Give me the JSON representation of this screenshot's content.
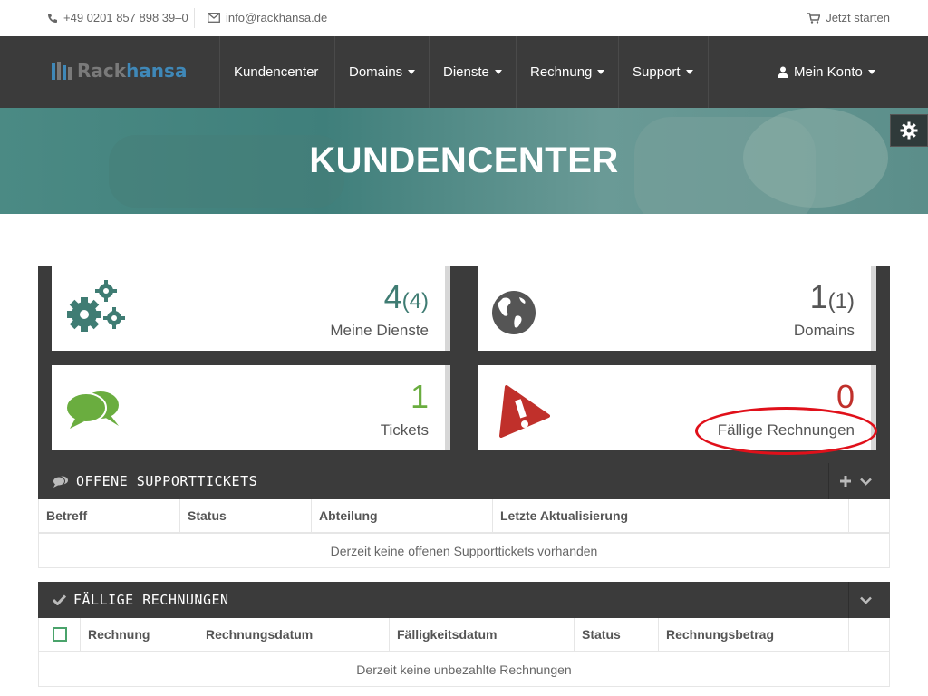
{
  "topbar": {
    "phone": "+49 0201 857 898 39–0",
    "email": "info@rackhansa.de",
    "start": "Jetzt starten"
  },
  "logo": {
    "part1": "Rack",
    "part2": "hansa"
  },
  "nav": {
    "items": [
      {
        "label": "Kundencenter"
      },
      {
        "label": "Domains"
      },
      {
        "label": "Dienste"
      },
      {
        "label": "Rechnung"
      },
      {
        "label": "Support"
      }
    ],
    "account": "Mein Konto"
  },
  "hero": {
    "title": "KUNDENCENTER"
  },
  "tiles": {
    "services": {
      "count": "4",
      "total": "(4)",
      "label": "Meine Dienste"
    },
    "domains": {
      "count": "1",
      "total": "(1)",
      "label": "Domains"
    },
    "tickets": {
      "count": "1",
      "label": "Tickets"
    },
    "invoices": {
      "count": "0",
      "label": "Fällige Rechnungen"
    }
  },
  "colors": {
    "services": "#3f7c73",
    "domains": "#555555",
    "tickets": "#6aad3f",
    "invoices": "#c0302b"
  },
  "support_panel": {
    "title": "OFFENE SUPPORTTICKETS",
    "columns": [
      "Betreff",
      "Status",
      "Abteilung",
      "Letzte Aktualisierung"
    ],
    "empty": "Derzeit keine offenen Supporttickets vorhanden"
  },
  "invoice_panel": {
    "title": "FÄLLIGE RECHNUNGEN",
    "columns": [
      "Rechnung",
      "Rechnungsdatum",
      "Fälligkeitsdatum",
      "Status",
      "Rechnungsbetrag"
    ],
    "empty": "Derzeit keine unbezahlte Rechnungen"
  }
}
